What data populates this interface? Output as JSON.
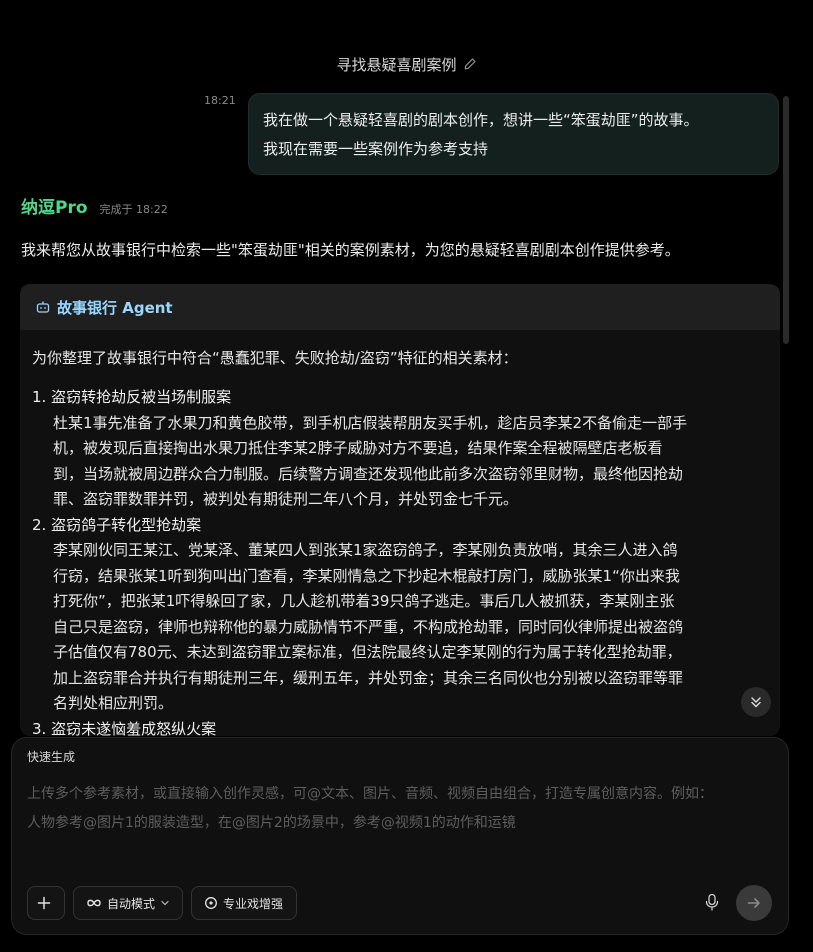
{
  "conversation": {
    "title": "寻找悬疑喜剧案例"
  },
  "user_message": {
    "time": "18:21",
    "lines": [
      "我在做一个悬疑轻喜剧的剧本创作，想讲一些“笨蛋劫匪”的故事。",
      "我现在需要一些案例作为参考支持"
    ]
  },
  "bot": {
    "name": "纳逗Pro",
    "status": "完成于 18:22",
    "intro": "我来帮您从故事银行中检索一些\"笨蛋劫匪\"相关的案例素材，为您的悬疑轻喜剧剧本创作提供参考。"
  },
  "agent_card": {
    "icon": "robot-icon",
    "title": "故事银行 Agent",
    "intro": "为你整理了故事银行中符合“愚蠢犯罪、失败抢劫/盗窃”特征的相关素材：",
    "cases": [
      {
        "title": "1. 盗窃转抢劫反被当场制服案",
        "lines": [
          "杜某1事先准备了水果刀和黄色胶带，到手机店假装帮朋友买手机，趁店员李某2不备偷走一部手",
          "机，被发现后直接掏出水果刀抵住李某2脖子威胁对方不要追，结果作案全程被隔壁店老板看",
          "到，当场就被周边群众合力制服。后续警方调查还发现他此前多次盗窃邻里财物，最终他因抢劫",
          "罪、盗窃罪数罪并罚，被判处有期徒刑二年八个月，并处罚金七千元。"
        ]
      },
      {
        "title": "2. 盗窃鸽子转化型抢劫案",
        "lines": [
          "李某刚伙同王某江、党某泽、董某四人到张某1家盗窃鸽子，李某刚负责放哨，其余三人进入鸽",
          "行窃，结果张某1听到狗叫出门查看，李某刚情急之下抄起木棍敲打房门，威胁张某1“你出来我",
          "打死你”，把张某1吓得躲回了家，几人趁机带着39只鸽子逃走。事后几人被抓获，李某刚主张",
          "自己只是盗窃，律师也辩称他的暴力威胁情节不严重，不构成抢劫罪，同时同伙律师提出被盗鸽",
          "子估值仅有780元、未达到盗窃罪立案标准，但法院最终认定李某刚的行为属于转化型抢劫罪，",
          "加上盗窃罪合并执行有期徒刑三年，缓刑五年，并处罚金；其余三名同伙也分别被以盗窃罪等罪",
          "名判处相应刑罚。"
        ]
      },
      {
        "title": "3. 盗窃未遂恼羞成怒纵火案",
        "lines": []
      }
    ]
  },
  "composer": {
    "mode_label": "快速生成",
    "placeholder_lines": [
      "上传多个参考素材，或直接输入创作灵感，可@文本、图片、音频、视频自由组合，打造专属创意内容。例如：",
      "人物参考@图片1的服装造型，在@图片2的场景中，参考@视频1的动作和运镜"
    ],
    "auto_mode_label": "自动模式",
    "enhance_label": "专业戏增强"
  },
  "colors": {
    "background": "#000000",
    "bot_name": "#4ed68a",
    "agent_title": "#9ad7ff",
    "user_bubble": "#13201d"
  }
}
